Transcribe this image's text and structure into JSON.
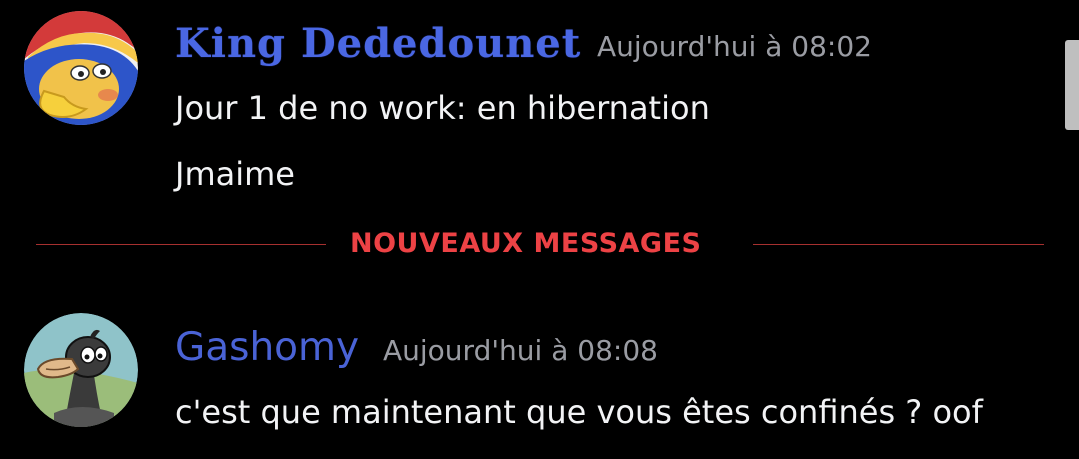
{
  "messages": [
    {
      "author": "King Dededounet",
      "timestamp": "Aujourd'hui à 08:02",
      "lines": [
        "Jour 1 de no work: en hibernation",
        "Jmaime"
      ]
    },
    {
      "author": "Gashomy",
      "timestamp": "Aujourd'hui à 08:08",
      "lines": [
        "c'est que maintenant que vous êtes confinés ? oof"
      ]
    }
  ],
  "divider": {
    "label": "NOUVEAUX MESSAGES",
    "color": "#ed4245"
  },
  "colors": {
    "background": "#000000",
    "author_name": "#4a67e3",
    "timestamp": "#9a9ca3",
    "message_text": "#f2f3f5"
  },
  "icons": {
    "avatar_1": "king-dedede-avatar",
    "avatar_2": "duck-avatar"
  }
}
